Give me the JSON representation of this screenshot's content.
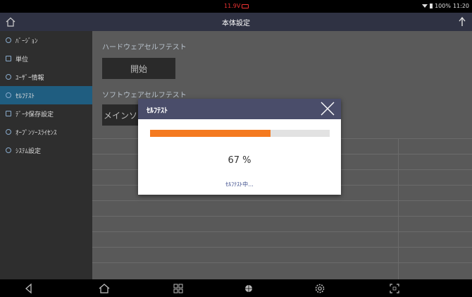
{
  "status_bar": {
    "voltage": "11.9V",
    "battery_text": "100%",
    "time": "11:20"
  },
  "header": {
    "title": "本体設定"
  },
  "sidebar": {
    "items": [
      {
        "label": "ﾊﾞｰｼﾞｮﾝ",
        "icon": "info-icon",
        "active": false
      },
      {
        "label": "単位",
        "icon": "unit-icon",
        "active": false
      },
      {
        "label": "ﾕｰｻﾞｰ情報",
        "icon": "user-icon",
        "active": false
      },
      {
        "label": "ｾﾙﾌﾃｽﾄ",
        "icon": "selftest-icon",
        "active": true
      },
      {
        "label": "ﾃﾞｰﾀ保存設定",
        "icon": "data-save-icon",
        "active": false
      },
      {
        "label": "ｵｰﾌﾟﾝｿｰｽﾗｲｾﾝｽ",
        "icon": "opensource-icon",
        "active": false
      },
      {
        "label": "ｼｽﾃﾑ設定",
        "icon": "system-icon",
        "active": false
      }
    ]
  },
  "main": {
    "hardware_title": "ハードウェアセルフテスト",
    "start_button": "開始",
    "software_title": "ソフトウェアセルフテスト",
    "main_unit_button": "メインソ"
  },
  "dialog": {
    "title": "ｾﾙﾌﾃｽﾄ",
    "progress": 0.67,
    "percent_text": "67 %",
    "status_text": "ｾﾙﾌﾃｽﾄ中..."
  },
  "colors": {
    "accent": "#f47a20",
    "header_bg": "#2f3243",
    "active_item": "#1f5d80"
  }
}
